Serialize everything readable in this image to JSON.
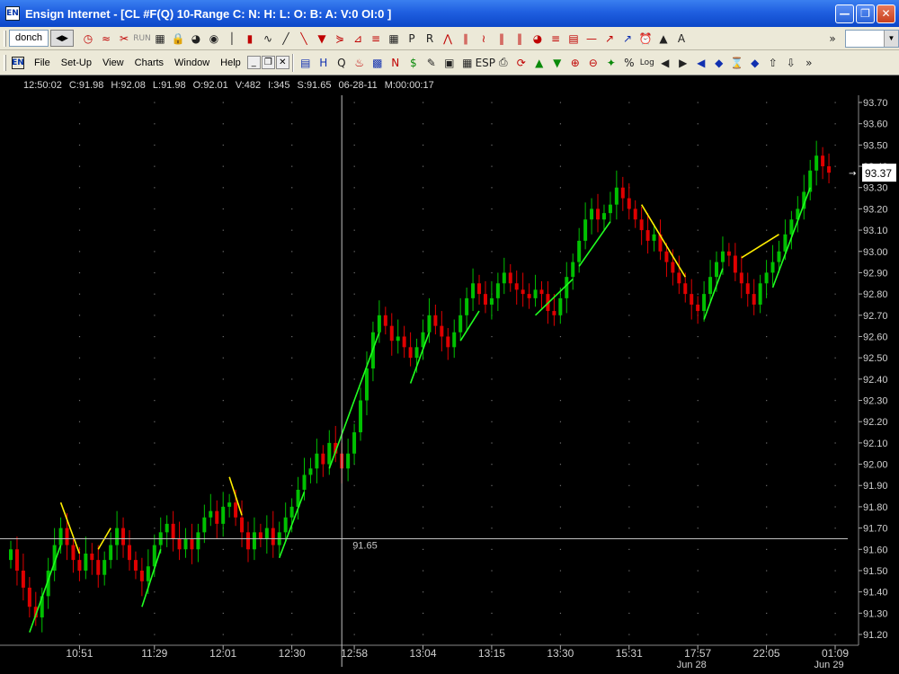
{
  "window": {
    "app_icon": "EN",
    "title": "Ensign Internet - [CL #F(Q) 10-Range C: N: H: L: O: B: A: V:0 OI:0 ]",
    "buttons": [
      "minimize-icon",
      "restore-icon",
      "close-icon"
    ]
  },
  "toolbar1": {
    "tab_label": "donch",
    "icons": [
      "clock-icon",
      "waves-icon",
      "scissors-icon",
      "run-icon",
      "grid-icon",
      "lock-icon",
      "gauge-icon",
      "globe-icon",
      "cursor-line-icon",
      "candle-icon",
      "wave-line-icon",
      "pencil-line-icon",
      "line-draw-icon",
      "arrow-down-icon",
      "fan-icon",
      "gann-icon",
      "fib-icon",
      "box-grid-icon",
      "box-p-icon",
      "box-r-icon",
      "pitchfork-icon",
      "parallel-icon",
      "zigzag-icon",
      "cycle-lines-icon",
      "cycle-lines2-icon",
      "spiral-icon",
      "levels-icon",
      "channel-icon",
      "hline-icon",
      "speed-icon",
      "fan2-icon",
      "alarm-icon",
      "triangle-icon",
      "text-icon"
    ],
    "overflow": "»"
  },
  "toolbar2": {
    "menu": [
      "File",
      "Set-Up",
      "View",
      "Charts",
      "Window",
      "Help"
    ],
    "icons": [
      "layout-icon",
      "h-icon",
      "q-icon",
      "fire-icon",
      "bar-chart-icon",
      "n-icon",
      "dollar-icon",
      "note-icon",
      "quote-icon",
      "page-icon",
      "esp-icon",
      "print-icon",
      "refresh-icon",
      "up-arrow-icon",
      "down-arrow-icon",
      "zoom-in-icon",
      "zoom-out-icon",
      "magic-icon",
      "percent-icon",
      "log-icon",
      "scroll-left-icon",
      "scroll-right-icon",
      "begin-icon",
      "expand-h-icon",
      "hourglass-icon",
      "expand-v-icon",
      "up-icon",
      "down-icon"
    ],
    "log_label": "Log",
    "percent_label": "%",
    "overflow": "»"
  },
  "status": {
    "time": "12:50:02",
    "close": "C:91.98",
    "high": "H:92.08",
    "low": "L:91.98",
    "open": "O:92.01",
    "volume": "V:482",
    "index": "I:345",
    "price": "S:91.65",
    "date": "06-28-11",
    "duration": "M:00:00:17"
  },
  "colors": {
    "background": "#000000",
    "up_bar": "#00c000",
    "down_bar": "#e00000",
    "up_trend": "#20ff20",
    "down_trend": "#ffee00",
    "crosshair": "#c0c0c0",
    "grid_dot": "#707070"
  },
  "chart_data": {
    "type": "candlestick",
    "ylim": [
      91.2,
      93.7
    ],
    "y_ticks": [
      "93.70",
      "93.60",
      "93.50",
      "93.40",
      "93.30",
      "93.20",
      "93.10",
      "93.00",
      "92.90",
      "92.80",
      "92.70",
      "92.60",
      "92.50",
      "92.40",
      "92.30",
      "92.20",
      "92.10",
      "92.00",
      "91.90",
      "91.80",
      "91.70",
      "91.60",
      "91.50",
      "91.40",
      "91.30",
      "91.20"
    ],
    "x_ticks": [
      {
        "label": "10:51",
        "bar": 11
      },
      {
        "label": "11:29",
        "bar": 23
      },
      {
        "label": "12:01",
        "bar": 34
      },
      {
        "label": "12:30",
        "bar": 45
      },
      {
        "label": "12:58",
        "bar": 55
      },
      {
        "label": "13:04",
        "bar": 66
      },
      {
        "label": "13:15",
        "bar": 77
      },
      {
        "label": "13:30",
        "bar": 88
      },
      {
        "label": "15:31",
        "bar": 99
      },
      {
        "label": "17:57",
        "bar": 110
      },
      {
        "label": "22:05",
        "bar": 121
      },
      {
        "label": "01:09",
        "bar": 132
      }
    ],
    "date_labels": [
      {
        "label": "Jun 28",
        "bar": 109
      },
      {
        "label": "Jun 29",
        "bar": 131
      }
    ],
    "crosshair": {
      "price": 91.65,
      "price_label": "91.65",
      "bar": 53
    },
    "last_price": "93.37",
    "closes": [
      91.6,
      91.5,
      91.42,
      91.33,
      91.28,
      91.38,
      91.5,
      91.62,
      91.7,
      91.62,
      91.55,
      91.5,
      91.58,
      91.55,
      91.48,
      91.55,
      91.62,
      91.7,
      91.62,
      91.55,
      91.5,
      91.45,
      91.52,
      91.62,
      91.68,
      91.72,
      91.65,
      91.6,
      91.65,
      91.6,
      91.68,
      91.75,
      91.78,
      91.72,
      91.8,
      91.82,
      91.75,
      91.68,
      91.6,
      91.68,
      91.65,
      91.7,
      91.62,
      91.68,
      91.75,
      91.8,
      91.88,
      91.95,
      91.98,
      92.05,
      92.0,
      92.1,
      92.05,
      91.98,
      92.05,
      92.15,
      92.3,
      92.45,
      92.62,
      92.7,
      92.65,
      92.58,
      92.6,
      92.55,
      92.5,
      92.55,
      92.62,
      92.7,
      92.65,
      92.6,
      92.55,
      92.62,
      92.7,
      92.78,
      92.85,
      92.8,
      92.75,
      92.78,
      92.85,
      92.9,
      92.85,
      92.82,
      92.8,
      92.78,
      92.82,
      92.8,
      92.72,
      92.7,
      92.78,
      92.88,
      92.95,
      93.05,
      93.15,
      93.2,
      93.15,
      93.18,
      93.22,
      93.3,
      93.25,
      93.2,
      93.15,
      93.1,
      93.05,
      93.08,
      93.0,
      92.95,
      92.9,
      92.85,
      92.8,
      92.75,
      92.72,
      92.8,
      92.88,
      92.95,
      93.0,
      92.98,
      92.9,
      92.85,
      92.8,
      92.75,
      92.85,
      92.9,
      92.95,
      93.0,
      93.08,
      93.15,
      93.2,
      93.28,
      93.38,
      93.45,
      93.4,
      93.37
    ]
  }
}
